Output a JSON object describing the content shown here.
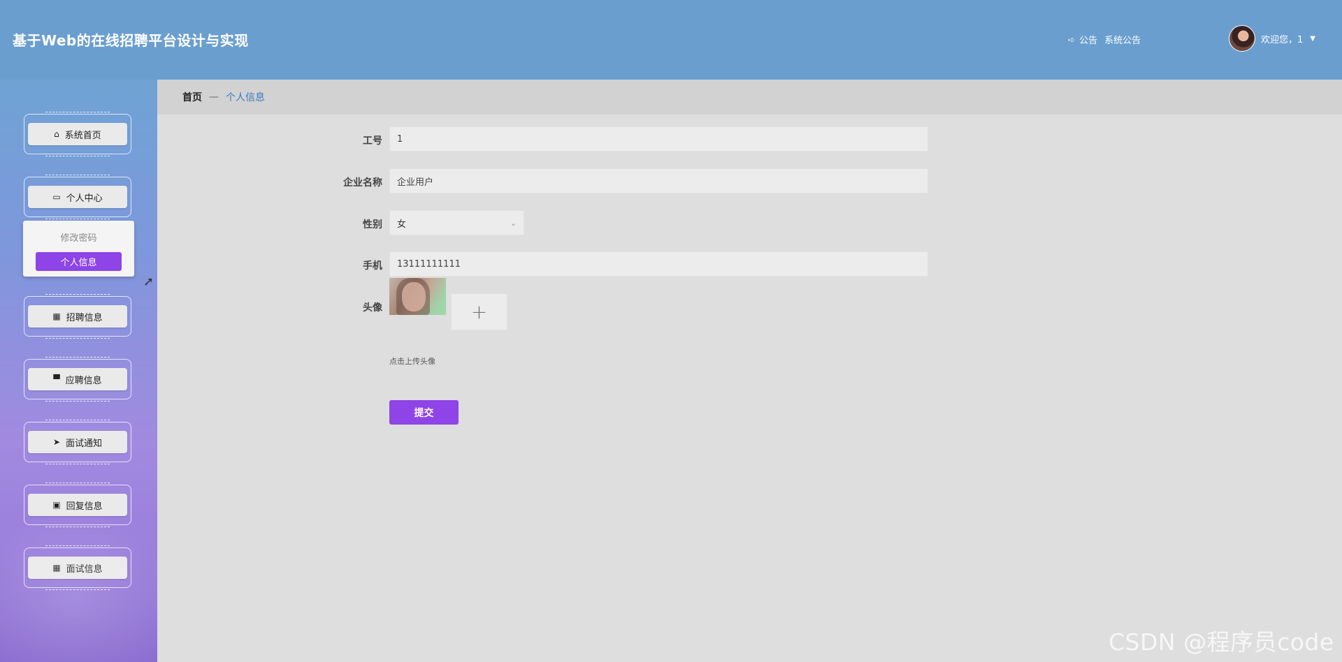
{
  "header": {
    "title": "基于Web的在线招聘平台设计与实现",
    "notice_label": "公告",
    "notice_link": "系统公告",
    "welcome": "欢迎您，1"
  },
  "sidebar": {
    "items": [
      {
        "label": "系统首页",
        "icon": "home-icon"
      },
      {
        "label": "个人中心",
        "icon": "window-icon"
      },
      {
        "label": "招聘信息",
        "icon": "grid-icon"
      },
      {
        "label": "应聘信息",
        "icon": "monitor-icon"
      },
      {
        "label": "面试通知",
        "icon": "paper-plane-icon"
      },
      {
        "label": "回复信息",
        "icon": "clipboard-icon"
      },
      {
        "label": "面试信息",
        "icon": "grid-icon"
      }
    ],
    "submenu": {
      "change_password": "修改密码",
      "personal_info": "个人信息"
    }
  },
  "breadcrumb": {
    "home": "首页",
    "separator": "—",
    "current": "个人信息"
  },
  "form": {
    "employee_id_label": "工号",
    "employee_id_value": "1",
    "company_label": "企业名称",
    "company_value": "企业用户",
    "gender_label": "性别",
    "gender_value": "女",
    "phone_label": "手机",
    "phone_value": "13111111111",
    "avatar_label": "头像",
    "upload_plus": "+",
    "upload_hint": "点击上传头像",
    "submit_label": "提交"
  },
  "watermark": "CSDN @程序员code",
  "colors": {
    "header": "#6a9ecf",
    "accent": "#8e44e6",
    "breadcrumb_link": "#3a7bbf"
  }
}
